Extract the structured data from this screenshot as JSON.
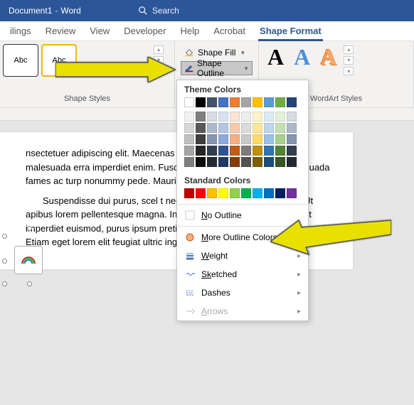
{
  "titlebar": {
    "doc_name": "Document1",
    "app_name": "Word",
    "search_placeholder": "Search"
  },
  "tabs": [
    {
      "label": "ilings"
    },
    {
      "label": "Review"
    },
    {
      "label": "View"
    },
    {
      "label": "Developer"
    },
    {
      "label": "Help"
    },
    {
      "label": "Acrobat"
    },
    {
      "label": "Shape Format",
      "active": true
    }
  ],
  "ribbon": {
    "shape_styles_label": "Shape Styles",
    "wordart_label": "WordArt Styles",
    "abc": "Abc",
    "shape_fill": "Shape Fill",
    "shape_outline": "Shape Outline"
  },
  "dropdown": {
    "theme_title": "Theme Colors",
    "standard_title": "Standard Colors",
    "no_outline": "o Outline",
    "no_outline_prefix": "N",
    "more_colors": "ore Outline Colors...",
    "more_colors_prefix": "M",
    "weight": "eight",
    "weight_prefix": "W",
    "sketched": "etched",
    "sketched_prefix": "Sk",
    "dashes": "Dashes",
    "arrows": "rrows",
    "arrows_prefix": "A",
    "theme_colors_row1": [
      "#ffffff",
      "#000000",
      "#44546a",
      "#4472c4",
      "#ed7d31",
      "#a5a5a5",
      "#ffc000",
      "#5b9bd5",
      "#70ad47",
      "#264478"
    ],
    "theme_shades": [
      [
        "#f2f2f2",
        "#7f7f7f",
        "#d5dce4",
        "#d9e1f2",
        "#fbe4d5",
        "#ededed",
        "#fff2cc",
        "#ddebf7",
        "#e2efd9",
        "#d5dce4"
      ],
      [
        "#d8d8d8",
        "#595959",
        "#adb9ca",
        "#b4c6e7",
        "#f7caac",
        "#dbdbdb",
        "#fee599",
        "#bdd7ee",
        "#c5e0b3",
        "#adb9ca"
      ],
      [
        "#bfbfbf",
        "#3f3f3f",
        "#8496b0",
        "#8eaadb",
        "#f4b083",
        "#c9c9c9",
        "#ffd965",
        "#9bc2e6",
        "#a8d08d",
        "#8496b0"
      ],
      [
        "#a5a5a5",
        "#262626",
        "#323f4f",
        "#2f5496",
        "#c55a11",
        "#7b7b7b",
        "#bf9000",
        "#2e75b5",
        "#538135",
        "#323f4f"
      ],
      [
        "#7f7f7f",
        "#0c0c0c",
        "#222a35",
        "#1f3864",
        "#833c0b",
        "#525252",
        "#7f6000",
        "#1e4e79",
        "#375623",
        "#222a35"
      ]
    ],
    "standard_colors": [
      "#c00000",
      "#ff0000",
      "#ffc000",
      "#ffff00",
      "#92d050",
      "#00b050",
      "#00b0f0",
      "#0070c0",
      "#002060",
      "#7030a0"
    ]
  },
  "document": {
    "p1": "nsectetuer adipiscing elit. Maecenas vinar ultricies, purus lectus malesuada erra imperdiet enim. Fusce est. Vivam s et netus et malesuada fames ac turp nonummy pede. Mauris et o itor. Donec laoreet nonu",
    "p2": "Suspendisse dui purus, scel t neque at sem venenatis eleifend. Ut apibus lorem pellentesque magna. Integer nulla. Donec blandit felis et imperdiet euismod, purus ipsum pretium metus, in lacinia est in amet orci. Etiam eget lorem elit feugiat ultric ing. Aliquam erat orta tristique."
  }
}
